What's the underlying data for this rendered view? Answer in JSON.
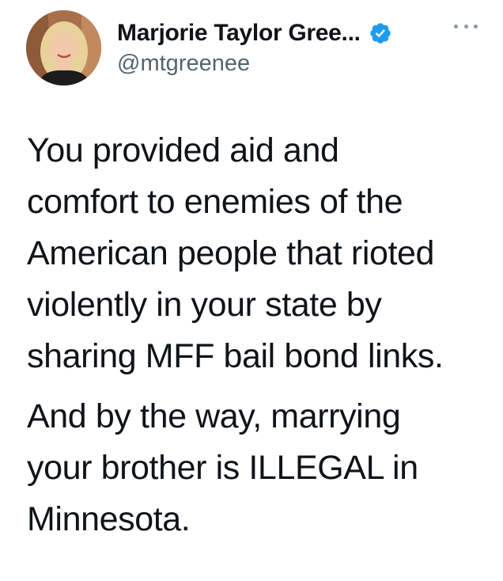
{
  "author": {
    "display_name": "Marjorie Taylor Gree...",
    "handle": "@mtgreenee",
    "verified": true
  },
  "icons": {
    "verified": "verified-badge-icon",
    "more": "more-options-icon"
  },
  "colors": {
    "text": "#0f1419",
    "secondary_text": "#536471",
    "verified_blue": "#1d9bf0",
    "background": "#ffffff"
  },
  "tweet": {
    "paragraphs": [
      "You provided aid and\ncomfort to enemies of the\nAmerican people that rioted\nviolently in your state by\nsharing MFF bail bond links.",
      "And by the way, marrying\nyour brother is ILLEGAL in\nMinnesota."
    ]
  }
}
